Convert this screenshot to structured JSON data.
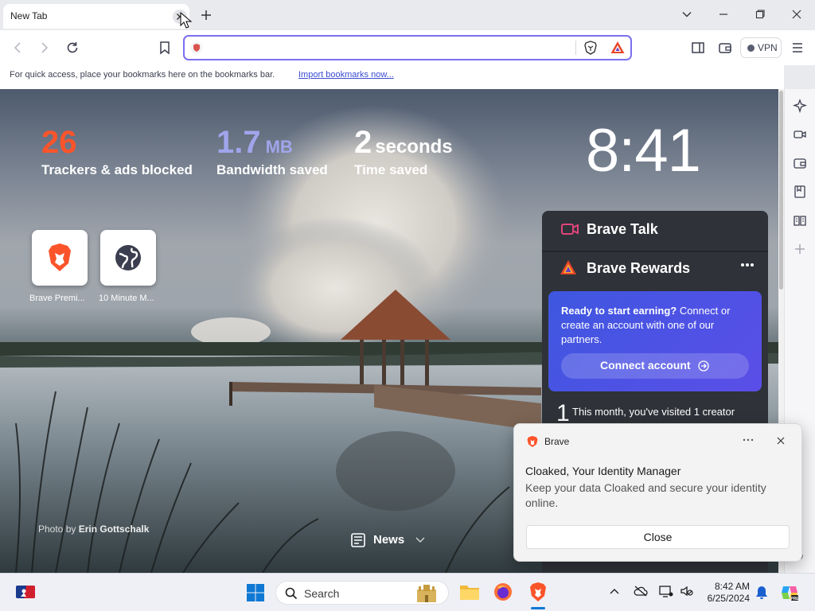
{
  "tab": {
    "title": "New Tab"
  },
  "address": {
    "value": "",
    "placeholder": ""
  },
  "toolbar": {
    "vpn_label": "VPN"
  },
  "bookmarks_bar": {
    "message": "For quick access, place your bookmarks here on the bookmarks bar.",
    "import_link": "Import bookmarks now..."
  },
  "stats": {
    "trackers": {
      "value": "26",
      "label": "Trackers & ads blocked",
      "color": "#fb542b"
    },
    "bandwidth": {
      "value": "1.7",
      "unit": "MB",
      "label": "Bandwidth saved",
      "color": "#a0a5eb"
    },
    "time": {
      "value": "2",
      "unit": "seconds",
      "label": "Time saved"
    }
  },
  "clock": "8:41",
  "top_sites": [
    {
      "label": "Brave Premi...",
      "icon": "brave-lion-icon"
    },
    {
      "label": "10 Minute M...",
      "icon": "globe-icon"
    }
  ],
  "brave_talk": {
    "title": "Brave Talk"
  },
  "brave_rewards": {
    "title": "Brave Rewards",
    "earn_bold": "Ready to start earning?",
    "earn_text": " Connect or create an account with one of our partners.",
    "connect_label": "Connect account",
    "visited_count": "1",
    "visited_text": "This month, you've visited 1 creator"
  },
  "news_label": "News",
  "photo_credit": {
    "prefix": "Photo by ",
    "author": "Erin Gottschalk"
  },
  "notification": {
    "app": "Brave",
    "title": "Cloaked, Your Identity Manager",
    "body": "Keep your data Cloaked and secure your identity online.",
    "close_label": "Close"
  },
  "taskbar": {
    "search_label": "Search",
    "time": "8:42 AM",
    "date": "6/25/2024"
  },
  "colors": {
    "accent": "#7b6ff0",
    "brave_orange": "#fb542b",
    "rewards_blue": "#3e57e0"
  }
}
